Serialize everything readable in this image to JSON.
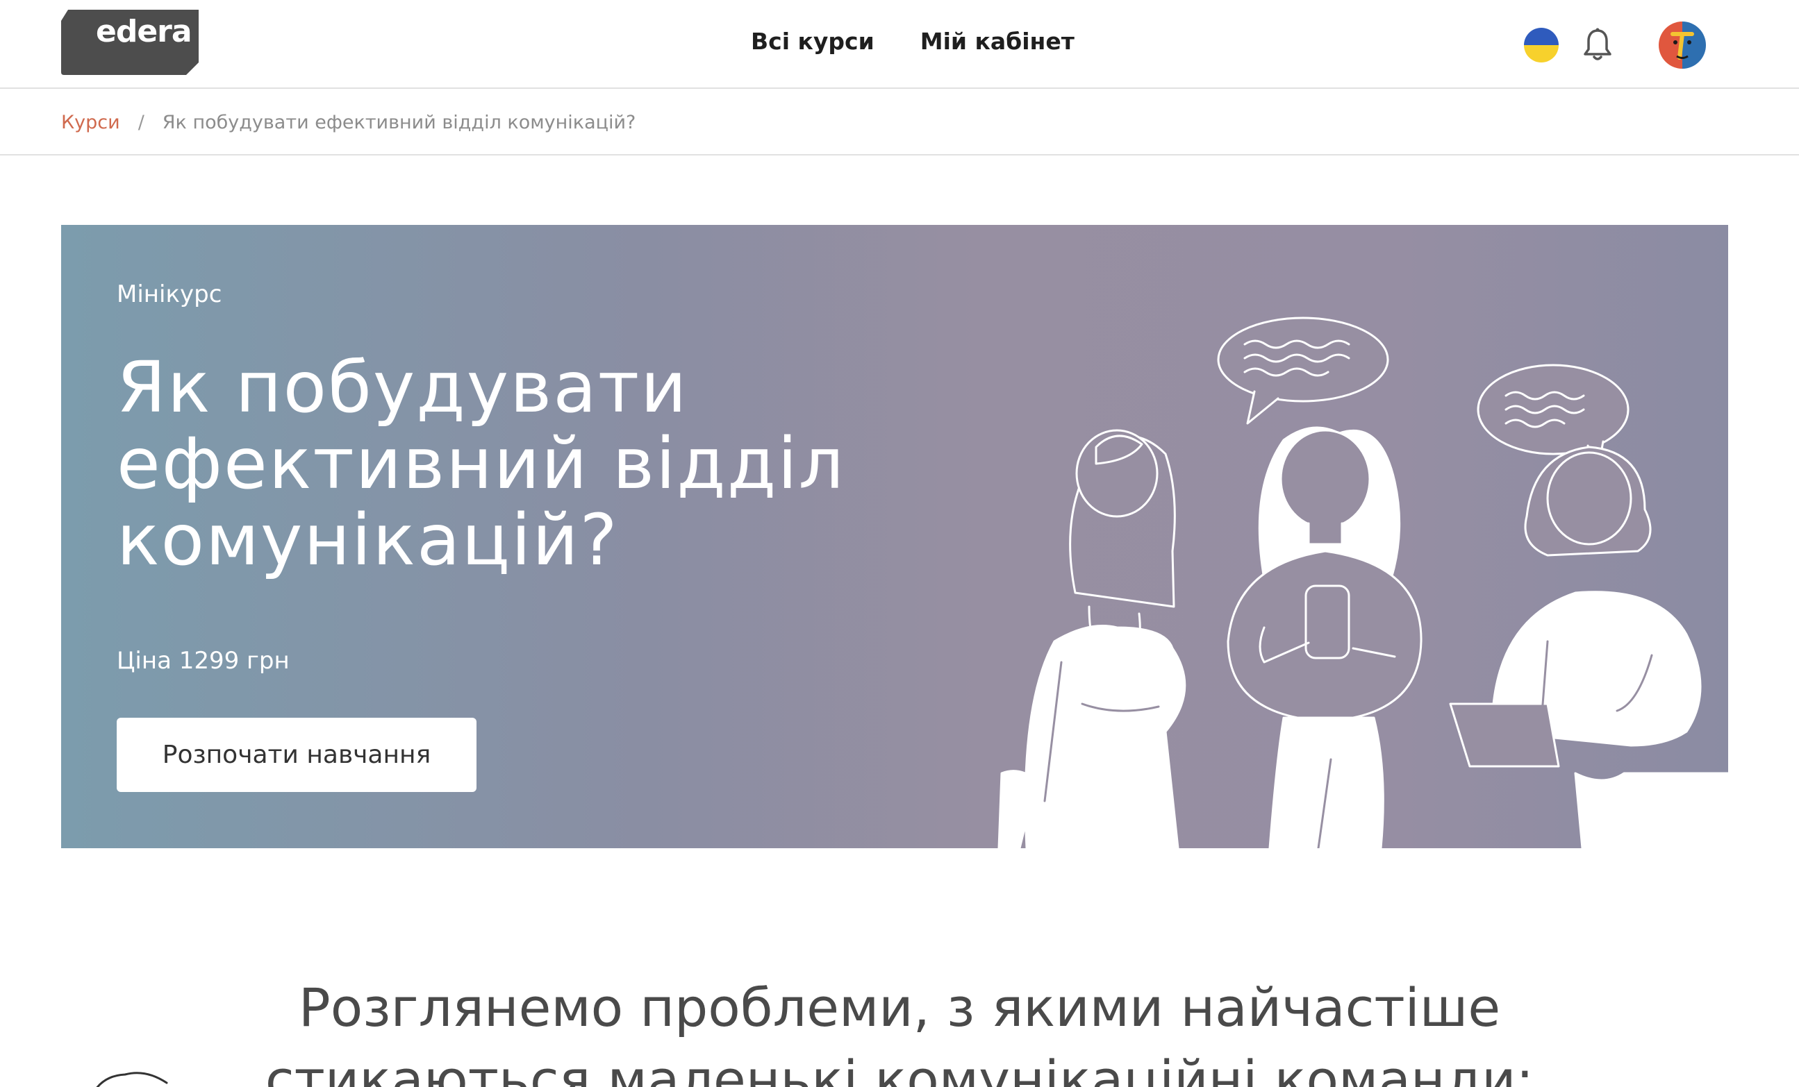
{
  "header": {
    "logo_text": "edera",
    "nav": [
      {
        "label": "Всі курси"
      },
      {
        "label": "Мій кабінет"
      }
    ],
    "icons": [
      "ukraine-flag-icon",
      "bell-icon",
      "user-avatar"
    ]
  },
  "breadcrumb": {
    "link": "Курси",
    "separator": "/",
    "current": "Як побудувати ефективний відділ комунікацій?"
  },
  "hero": {
    "kicker": "Мінікурс",
    "title": "Як побудувати ефективний відділ комунікацій?",
    "price": "Ціна 1299 грн",
    "cta_label": "Розпочати навчання"
  },
  "section": {
    "heading": "Розглянемо проблеми, з якими найчастіше стикаються маленькі комунікаційні команди:"
  },
  "colors": {
    "accent_link": "#d06a4e",
    "hero_gradient_start": "#7c9cad",
    "hero_gradient_end": "#8b8ca3",
    "logo_bg": "#4d4d4d"
  }
}
